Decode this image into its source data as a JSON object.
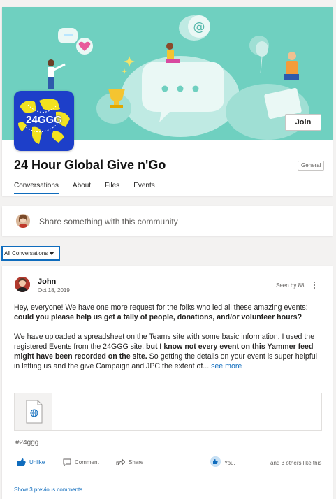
{
  "header": {
    "logo_text": "24GGG",
    "join_label": "Join",
    "title": "24 Hour Global Give n'Go",
    "badge": "General",
    "tabs": [
      {
        "label": "Conversations",
        "active": true
      },
      {
        "label": "About",
        "active": false
      },
      {
        "label": "Files",
        "active": false
      },
      {
        "label": "Events",
        "active": false
      }
    ]
  },
  "composer": {
    "placeholder": "Share something with this community"
  },
  "filter": {
    "selected": "All Conversations"
  },
  "post": {
    "author": "John",
    "date": "Oct 18, 2019",
    "seen_by": "Seen by 88",
    "p1_a": "Hey, everyone!  We have one more request for the folks who led all these amazing events: ",
    "p1_b": " could you please help us get a tally of people, donations, and/or volunteer hours?",
    "p2_a": "We have uploaded a spreadsheet on the Teams site with some basic information.  I used the registered Events from the 24GGG site, ",
    "p2_b": "but I know not every event on this Yammer feed might have been recorded on the site.",
    "p2_c": "  So getting the details on your event is super helpful in letting us and the give Campaign and JPC the extent of...",
    "see_more": " see more",
    "hashtag": "#24ggg",
    "actions": {
      "like": "Unlike",
      "comment": "Comment",
      "share": "Share",
      "likers": "You,",
      "others": "and 3 others like this"
    },
    "show_previous": "Show 3 previous comments"
  },
  "colors": {
    "banner": "#6fd0c0",
    "accent": "#0f6cbd",
    "logo_bg": "#1d3fc9",
    "logo_map": "#f2e21f"
  }
}
